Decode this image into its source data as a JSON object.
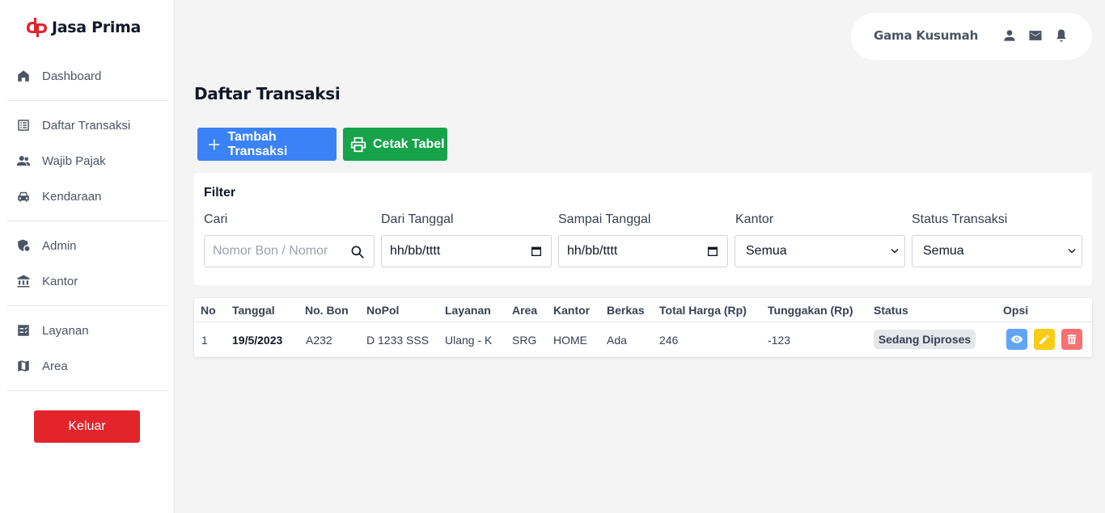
{
  "brand": {
    "name": "Jasa Prima",
    "accent": "#e3242b"
  },
  "sidebar": {
    "items": [
      {
        "label": "Dashboard",
        "icon": "home-icon"
      },
      {
        "label": "Daftar Transaksi",
        "icon": "list-icon"
      },
      {
        "label": "Wajib Pajak",
        "icon": "users-icon"
      },
      {
        "label": "Kendaraan",
        "icon": "car-icon"
      },
      {
        "label": "Admin",
        "icon": "admin-shield-icon"
      },
      {
        "label": "Kantor",
        "icon": "bank-icon"
      },
      {
        "label": "Layanan",
        "icon": "checklist-icon"
      },
      {
        "label": "Area",
        "icon": "map-icon"
      }
    ],
    "logout_label": "Keluar"
  },
  "header": {
    "user_name": "Gama Kusumah"
  },
  "page": {
    "title": "Daftar Transaksi",
    "add_button": "Tambah Transaksi",
    "print_button": "Cetak Tabel"
  },
  "filter": {
    "title": "Filter",
    "search_label": "Cari",
    "search_placeholder": "Nomor Bon / Nomor",
    "from_label": "Dari Tanggal",
    "from_value": "hh/bb/tttt",
    "to_label": "Sampai Tanggal",
    "to_value": "hh/bb/tttt",
    "office_label": "Kantor",
    "office_value": "Semua",
    "status_label": "Status Transaksi",
    "status_value": "Semua"
  },
  "table": {
    "columns": [
      "No",
      "Tanggal",
      "No. Bon",
      "NoPol",
      "Layanan",
      "Area",
      "Kantor",
      "Berkas",
      "Total Harga (Rp)",
      "Tunggakan (Rp)",
      "Status",
      "Opsi"
    ],
    "rows": [
      {
        "no": "1",
        "tanggal": "19/5/2023",
        "no_bon": "A232",
        "nopol": "D 1233 SSS",
        "layanan": "Ulang - K",
        "area": "SRG",
        "kantor": "HOME",
        "berkas": "Ada",
        "total_harga": "246",
        "tunggakan": "-123",
        "status": "Sedang Diproses"
      }
    ]
  }
}
